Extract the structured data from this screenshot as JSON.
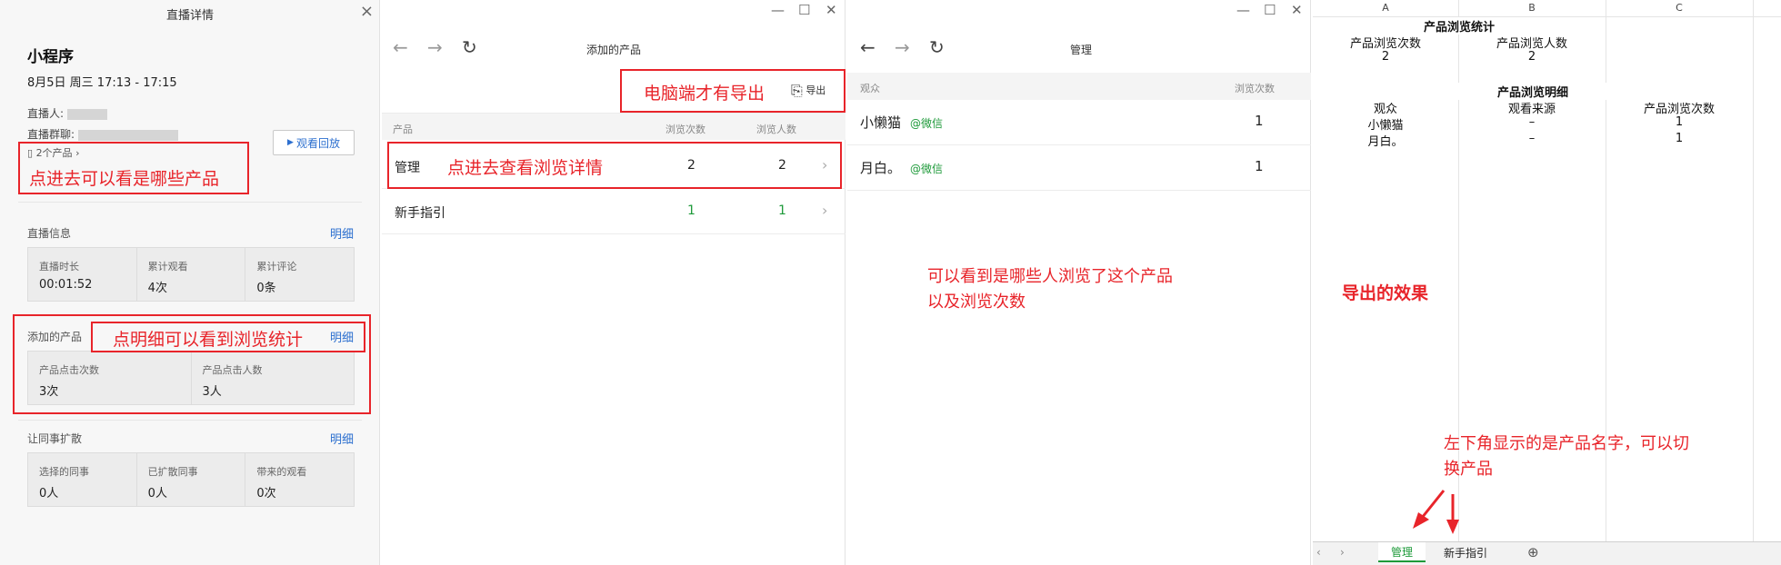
{
  "panel1": {
    "title": "直播详情",
    "close": "×",
    "mp_name": "小程序",
    "time": "8月5日 周三 17:13 - 17:15",
    "anchor_label": "直播人:",
    "group_label": "直播群聊:",
    "products_link": "2个产品",
    "replay_button": "观看回放",
    "live_info": {
      "title": "直播信息",
      "link": "明细",
      "stats": [
        {
          "label": "直播时长",
          "value": "00:01:52"
        },
        {
          "label": "累计观看",
          "value": "4次"
        },
        {
          "label": "累计评论",
          "value": "0条"
        }
      ]
    },
    "added_products": {
      "title": "添加的产品",
      "link": "明细",
      "stats": [
        {
          "label": "产品点击次数",
          "value": "3次"
        },
        {
          "label": "产品点击人数",
          "value": "3人"
        }
      ]
    },
    "spread": {
      "title": "让同事扩散",
      "link": "明细",
      "stats": [
        {
          "label": "选择的同事",
          "value": "0人"
        },
        {
          "label": "已扩散同事",
          "value": "0人"
        },
        {
          "label": "带来的观看",
          "value": "0次"
        }
      ]
    }
  },
  "panel2": {
    "title": "添加的产品",
    "export": "导出",
    "headers": [
      "产品",
      "浏览次数",
      "浏览人数"
    ],
    "rows": [
      {
        "name": "管理",
        "views": "2",
        "viewers": "2"
      },
      {
        "name": "新手指引",
        "views": "1",
        "viewers": "1"
      }
    ]
  },
  "panel3": {
    "title": "管理",
    "headers": [
      "观众",
      "浏览次数"
    ],
    "rows": [
      {
        "name": "小懒猫",
        "source": "@微信",
        "views": "1"
      },
      {
        "name": "月白。",
        "source": "@微信",
        "views": "1"
      }
    ]
  },
  "panel4": {
    "columns": [
      "A",
      "B",
      "C"
    ],
    "stats_title": "产品浏览统计",
    "stats_headers": [
      "产品浏览次数",
      "产品浏览人数"
    ],
    "stats_values": [
      "2",
      "2"
    ],
    "detail_title": "产品浏览明细",
    "detail_headers": [
      "观众",
      "观看来源",
      "产品浏览次数"
    ],
    "detail_rows": [
      [
        "小懒猫",
        "–",
        "1"
      ],
      [
        "月白。",
        "–",
        "1"
      ]
    ],
    "sheets": [
      "管理",
      "新手指引"
    ]
  },
  "annotations": {
    "a1": "点进去可以看是哪些产品",
    "a2": "点明细可以看到浏览统计",
    "a3": "电脑端才有导出",
    "a4": "点进去查看浏览详情",
    "a5_line1": "可以看到是哪些人浏览了这个产品",
    "a5_line2": "以及浏览次数",
    "a6": "导出的效果",
    "a7_line1": "左下角显示的是产品名字，可以切",
    "a7_line2": "换产品"
  },
  "colors": {
    "annotation": "#e8242a",
    "link": "#2c6fcf",
    "green": "#1e9a3a"
  }
}
